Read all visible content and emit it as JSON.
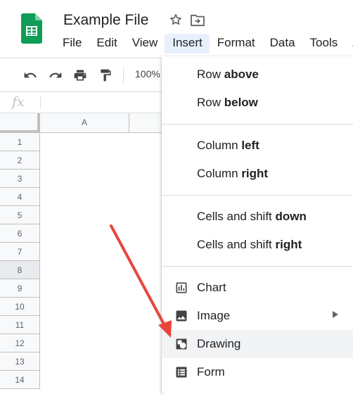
{
  "document": {
    "title": "Example File"
  },
  "menubar": [
    "File",
    "Edit",
    "View",
    "Insert",
    "Format",
    "Data",
    "Tools",
    "A"
  ],
  "toolbar": {
    "zoom": "100%"
  },
  "formula_bar": {
    "fx_label": "fx"
  },
  "grid": {
    "column_headers": [
      "A"
    ],
    "row_numbers": [
      "1",
      "2",
      "3",
      "4",
      "5",
      "6",
      "7",
      "8",
      "9",
      "10",
      "11",
      "12",
      "13",
      "14"
    ],
    "selected_row": "8"
  },
  "insert_menu": {
    "row_above": {
      "text": "Row ",
      "bold": "above"
    },
    "row_below": {
      "text": "Row ",
      "bold": "below"
    },
    "column_left": {
      "text": "Column ",
      "bold": "left"
    },
    "column_right": {
      "text": "Column ",
      "bold": "right"
    },
    "cells_down": {
      "text": "Cells and shift ",
      "bold": "down"
    },
    "cells_right": {
      "text": "Cells and shift ",
      "bold": "right"
    },
    "chart": "Chart",
    "image": "Image",
    "drawing": "Drawing",
    "form": "Form"
  },
  "icons": {
    "logo": "google-sheets-logo",
    "star": "star-icon",
    "move": "move-to-folder-icon",
    "undo": "undo-icon",
    "redo": "redo-icon",
    "print": "print-icon",
    "paint_format": "paint-format-icon",
    "chart": "chart-icon",
    "image": "image-icon",
    "drawing": "drawing-icon",
    "form": "form-icon"
  },
  "colors": {
    "sheets_green": "#0f9d58",
    "annotation_red": "#e8453c",
    "menu_active_bg": "#e8f0fe",
    "menu_hover_bg": "#f1f3f4"
  }
}
